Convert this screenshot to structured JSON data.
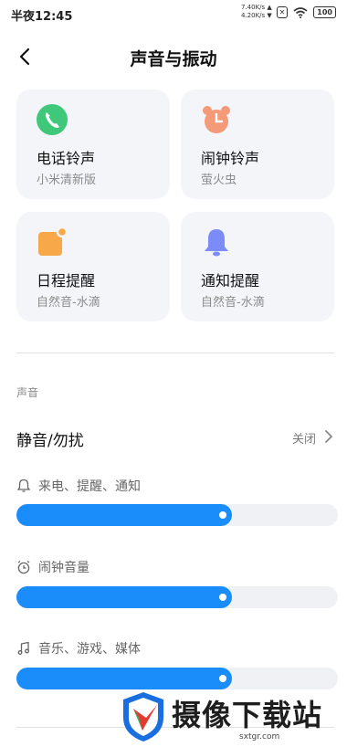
{
  "status_bar": {
    "time": "半夜12:45",
    "upload_speed": "7.40K/s ▲",
    "download_speed": "4.20K/s ▼",
    "sim_icon": "sim-x-icon",
    "wifi_icon": "wifi-icon",
    "battery": "100"
  },
  "header": {
    "title": "声音与振动",
    "back_icon": "back-arrow-icon"
  },
  "cards": [
    {
      "name": "电话铃声",
      "sub": "小米清新版",
      "icon": "phone-icon",
      "color": "#3fc77a"
    },
    {
      "name": "闹钟铃声",
      "sub": "萤火虫",
      "icon": "alarm-clock-icon",
      "color": "#f59a78"
    },
    {
      "name": "日程提醒",
      "sub": "自然音-水滴",
      "icon": "calendar-note-icon",
      "color": "#f7a94a"
    },
    {
      "name": "通知提醒",
      "sub": "自然音-水滴",
      "icon": "bell-icon",
      "color": "#7b8cf6"
    }
  ],
  "sound_section": {
    "label": "声音",
    "mute": {
      "label": "静音/勿扰",
      "value": "关闭"
    },
    "volumes": [
      {
        "label": "来电、提醒、通知",
        "icon": "bell-outline-icon",
        "level": 0.67
      },
      {
        "label": "闹钟音量",
        "icon": "clock-outline-icon",
        "level": 0.67
      },
      {
        "label": "音乐、游戏、媒体",
        "icon": "music-note-icon",
        "level": 0.67
      }
    ]
  },
  "colors": {
    "accent": "#1a8dfa",
    "card_bg": "#f4f5f9"
  },
  "watermark": {
    "text": "摄像下载站",
    "url": "sxtgr.com"
  }
}
